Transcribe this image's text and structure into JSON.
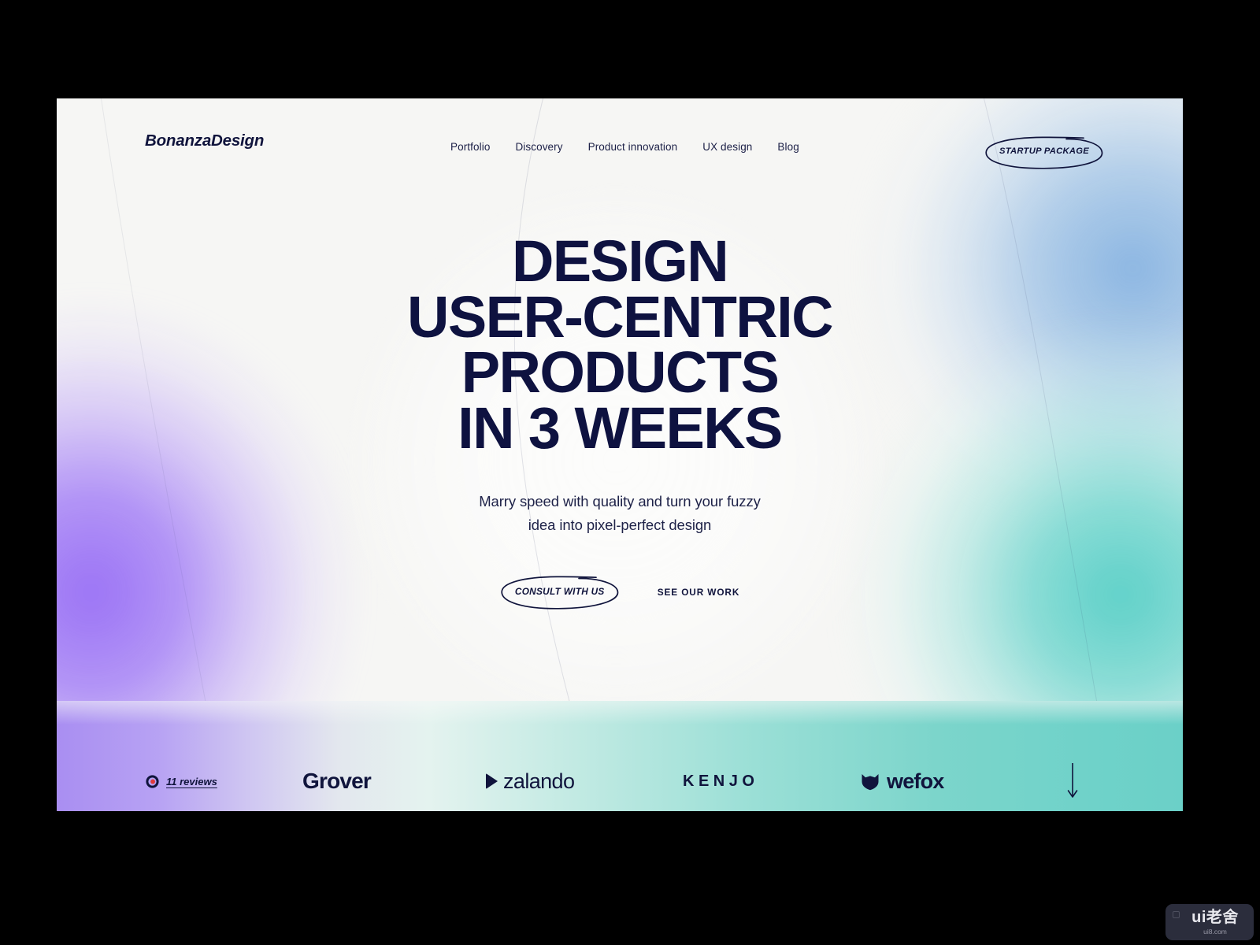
{
  "site": {
    "logo": "BonanzaDesign"
  },
  "nav": {
    "items": [
      {
        "label": "Portfolio"
      },
      {
        "label": "Discovery"
      },
      {
        "label": "Product innovation"
      },
      {
        "label": "UX design"
      },
      {
        "label": "Blog"
      }
    ],
    "cta_label": "STARTUP PACKAGE"
  },
  "hero": {
    "headline_lines": [
      "DESIGN",
      "USER-CENTRIC",
      "PRODUCTS",
      "IN 3 WEEKS"
    ],
    "subtitle_lines": [
      "Marry speed with quality and turn your fuzzy",
      "idea into pixel-perfect design"
    ],
    "primary_cta": "CONSULT WITH US",
    "secondary_cta": "SEE OUR WORK"
  },
  "logos": {
    "reviews_count": "11 reviews",
    "clutch_icon": "clutch-c-icon",
    "brands": [
      {
        "name": "Grover",
        "icon": ""
      },
      {
        "name": "zalando",
        "icon": "zalando-triangle-icon"
      },
      {
        "name": "KENJO",
        "icon": ""
      },
      {
        "name": "wefox",
        "icon": "wefox-shield-icon"
      }
    ],
    "scroll_icon": "arrow-down-icon"
  },
  "watermark": {
    "main": "ui老舍",
    "sub": "ui8.com"
  },
  "colors": {
    "ink": "#10143c",
    "purple": "#966cf5",
    "blue": "#82b0e0",
    "teal": "#56cec6",
    "clutch_red": "#e03a3a",
    "page_bg": "#f6f6f4"
  }
}
